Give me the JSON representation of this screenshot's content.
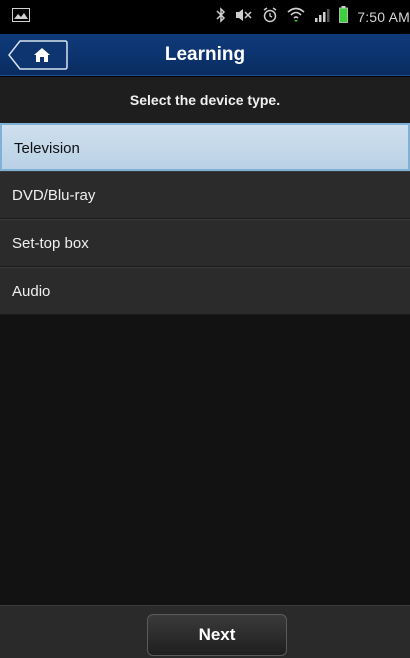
{
  "status_bar": {
    "time": "7:50 AM",
    "icons": [
      "image-icon",
      "bluetooth-icon",
      "mute-icon",
      "alarm-icon",
      "wifi-icon",
      "signal-icon",
      "battery-icon"
    ]
  },
  "header": {
    "title": "Learning",
    "home_icon": "home-icon"
  },
  "instruction": "Select the device type.",
  "devices": [
    {
      "label": "Television",
      "selected": true
    },
    {
      "label": "DVD/Blu-ray",
      "selected": false
    },
    {
      "label": "Set-top box",
      "selected": false
    },
    {
      "label": "Audio",
      "selected": false
    }
  ],
  "footer": {
    "next_label": "Next"
  },
  "colors": {
    "header_bg": "#0c3470",
    "selected_bg": "#c7dbeb",
    "battery": "#3cd13c"
  }
}
